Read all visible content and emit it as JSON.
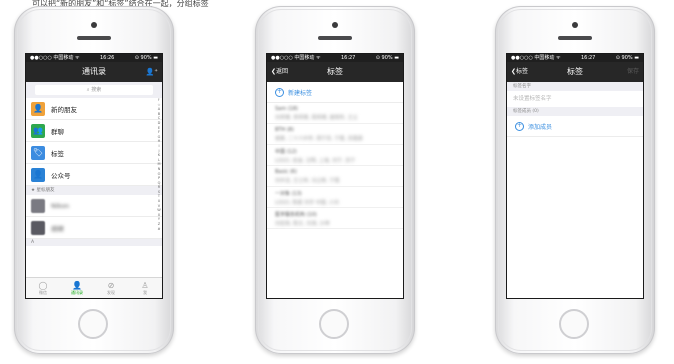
{
  "caption": "可以把“新的朋友”和“标签”结合在一起，分组标签",
  "colors": {
    "wechat_green": "#1aad19",
    "link_blue": "#3b8fe0",
    "navbar_dark": "#272727"
  },
  "phone1": {
    "status": {
      "carrier": "●●○○○ 中国移动 ᯤ",
      "time": "16:26",
      "battery": "⊙ 90% ▬"
    },
    "navbar": {
      "title": "通讯录",
      "add_icon": "add-contact-icon"
    },
    "search": {
      "placeholder": "搜索"
    },
    "rows": [
      {
        "label": "新的朋友",
        "icon": "add-friend-icon",
        "color": "#f0a23a"
      },
      {
        "label": "群聊",
        "icon": "group-chat-icon",
        "color": "#2fa84f"
      },
      {
        "label": "标签",
        "icon": "tag-icon",
        "color": "#3c8ce0"
      },
      {
        "label": "公众号",
        "icon": "official-account-icon",
        "color": "#2a82d6"
      }
    ],
    "section_label": "★ 星标朋友",
    "contacts": [
      {
        "name": "Nikon"
      },
      {
        "name": "胡继"
      }
    ],
    "section_a": "A",
    "index_letters": [
      "↑",
      "☆",
      "A",
      "B",
      "C",
      "D",
      "E",
      "F",
      "G",
      "H",
      "I",
      "J",
      "K",
      "L",
      "M",
      "N",
      "O",
      "P",
      "Q",
      "R",
      "S",
      "T",
      "U",
      "V",
      "W",
      "X",
      "Y",
      "Z",
      "#"
    ],
    "tabs": [
      {
        "label": "微信",
        "icon": "chat-bubble-icon"
      },
      {
        "label": "通讯录",
        "icon": "contacts-icon"
      },
      {
        "label": "发现",
        "icon": "compass-icon"
      },
      {
        "label": "我",
        "icon": "person-icon"
      }
    ]
  },
  "phone2": {
    "status": {
      "carrier": "●●○○○ 中国移动 ᯤ",
      "time": "16:27",
      "battery": "⊙ 90% ▬"
    },
    "navbar": {
      "back": "返回",
      "title": "标签"
    },
    "new_tag": "新建标签",
    "tags": [
      {
        "name": "Sam (18)",
        "members": "刘师傅, 李师傅, 周师傅, 建筑所, 王立"
      },
      {
        "name": "BTH (8)",
        "members": "谢某, 二十六中学, 周宁苏, 宁霞, 苏霞霖"
      },
      {
        "name": "中国 (12)",
        "members": "LOGO, 史迪, 汪明, 上海, 刘宁, 苏宁"
      },
      {
        "name": "Basic (6)",
        "members": "刘中洁, 王士林, 冯立新, 宁霞"
      },
      {
        "name": "一对象 (13)",
        "members": "LOGO, 陈晨 刘宇 中国, 小刘"
      },
      {
        "name": "医学服务机构 (10)",
        "members": "刘宏扬, 陈文, 刘涛, 沙坤"
      }
    ]
  },
  "phone3": {
    "status": {
      "carrier": "●●○○○ 中国移动 ᯤ",
      "time": "16:27",
      "battery": "⊙ 90% ▬"
    },
    "navbar": {
      "back": "标签",
      "title": "标签",
      "save": "保存"
    },
    "name_section": "标签名字",
    "name_placeholder": "未设置标签名字",
    "members_section": "标签成员 (0)",
    "add_member": "添加成员"
  }
}
